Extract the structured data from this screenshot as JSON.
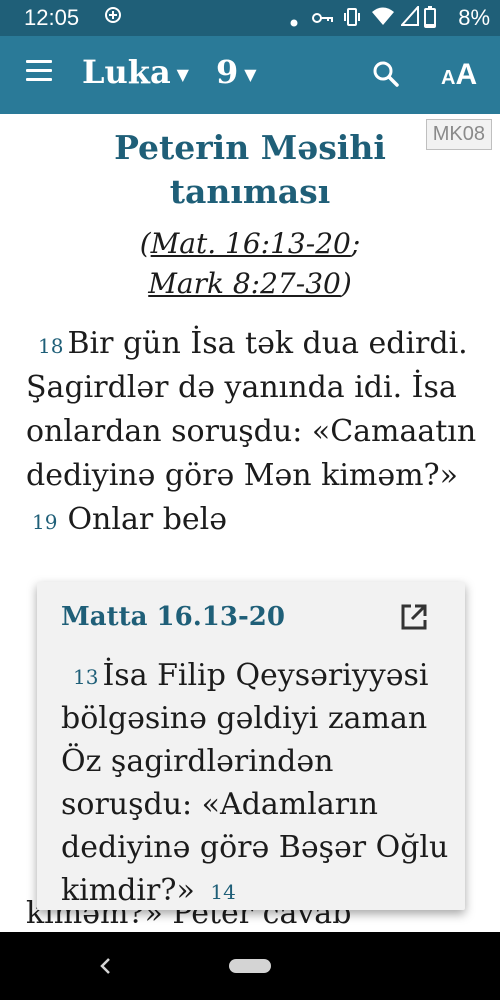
{
  "status_bar": {
    "time": "12:05",
    "battery_percent": "8%",
    "icons": [
      "data-saver-icon",
      "notification-dot-icon",
      "vpn-key-icon",
      "vibrate-icon",
      "wifi-icon",
      "battery-icon"
    ]
  },
  "app_bar": {
    "book": "Luka",
    "chapter": "9",
    "icons": [
      "menu-icon",
      "search-icon",
      "font-size-icon"
    ],
    "font_icon_small": "A",
    "font_icon_big": "A"
  },
  "content": {
    "version_badge": "MK08",
    "heading": "Peterin Məsihi tanıması",
    "parallel_open": "(",
    "parallel_ref1": "Mat. 16:13-20",
    "parallel_sep": ";",
    "parallel_ref2": "Mark 8:27-30",
    "parallel_close": ")",
    "verse18_num": "18",
    "verse18_text": "Bir gün İsa tək dua edirdi. Şagirdlər də yanında idi. İsa onlardan soruşdu: «Camaatın dediyinə görə Mən kiməm?»",
    "verse19_num": "19",
    "verse19_text": "Onlar belə",
    "hidden_line": "kiməm?» Peter cavab"
  },
  "popup": {
    "title": "Matta 16.13-20",
    "verse13_num": "13",
    "verse13_text": "İsa Filip Qeysəriyyəsi bölgəsinə gəldiyi zaman Öz şagirdlərindən soruşdu: «Adamların dediyinə görə Bəşər Oğlu kimdir?»",
    "verse14_num": "14"
  },
  "colors": {
    "status_bar": "#1f5f78",
    "app_bar": "#2a7a98",
    "accent": "#1f5f78",
    "popup_bg": "#f2f2f2",
    "nav_bar": "#000000"
  }
}
